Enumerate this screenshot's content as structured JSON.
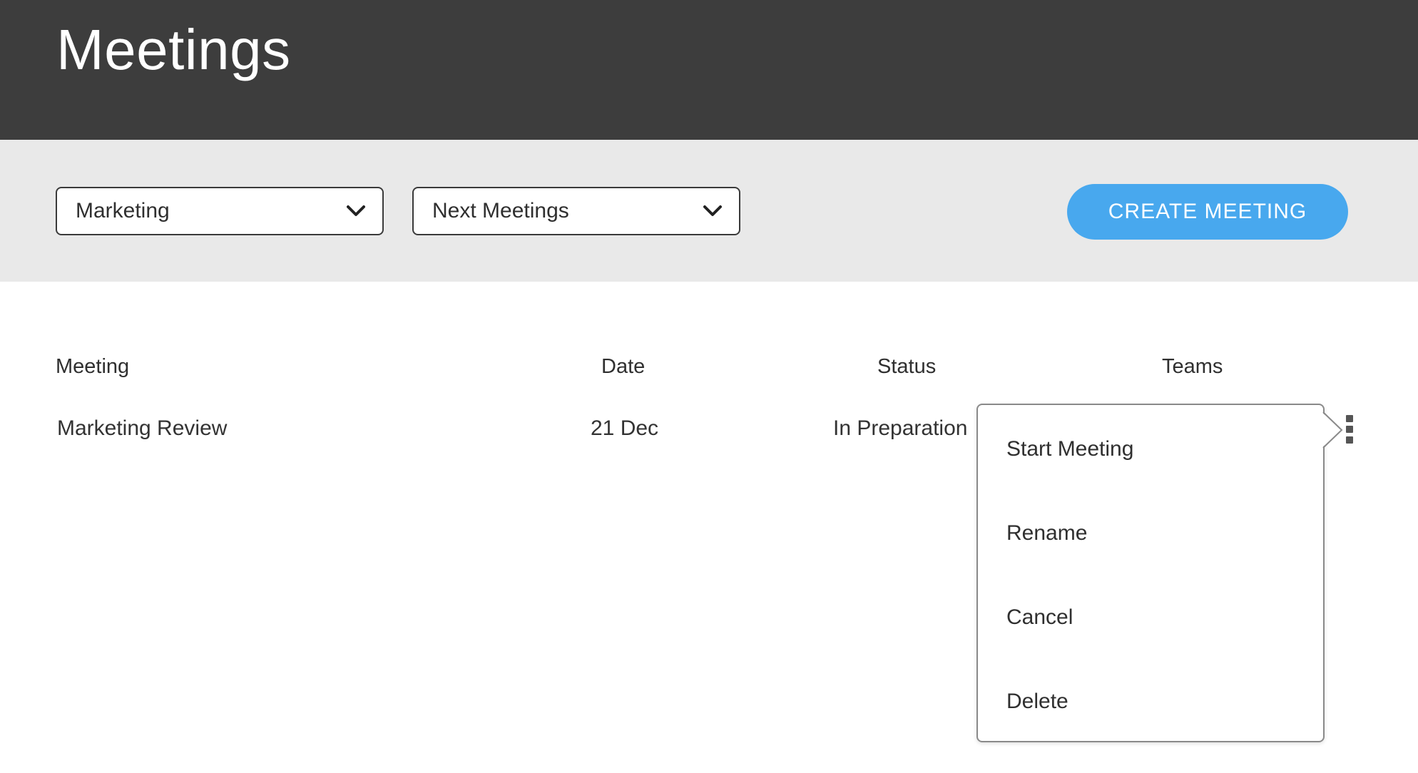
{
  "header": {
    "title": "Meetings"
  },
  "toolbar": {
    "team_select": {
      "value": "Marketing"
    },
    "period_select": {
      "value": "Next Meetings"
    },
    "create_button": "CREATE MEETING"
  },
  "table": {
    "columns": [
      "Meeting",
      "Date",
      "Status",
      "Teams"
    ],
    "rows": [
      {
        "meeting": "Marketing Review",
        "date": "21 Dec",
        "status": "In Preparation",
        "teams": ""
      }
    ]
  },
  "context_menu": {
    "items": [
      "Start Meeting",
      "Rename",
      "Cancel",
      "Delete"
    ]
  },
  "colors": {
    "header_bg": "#3d3d3d",
    "toolbar_bg": "#e9e9e9",
    "accent": "#48a8ee"
  },
  "icons": {
    "select_chevron": "chevron-down-icon",
    "row_menu": "vertical-dots-icon"
  }
}
